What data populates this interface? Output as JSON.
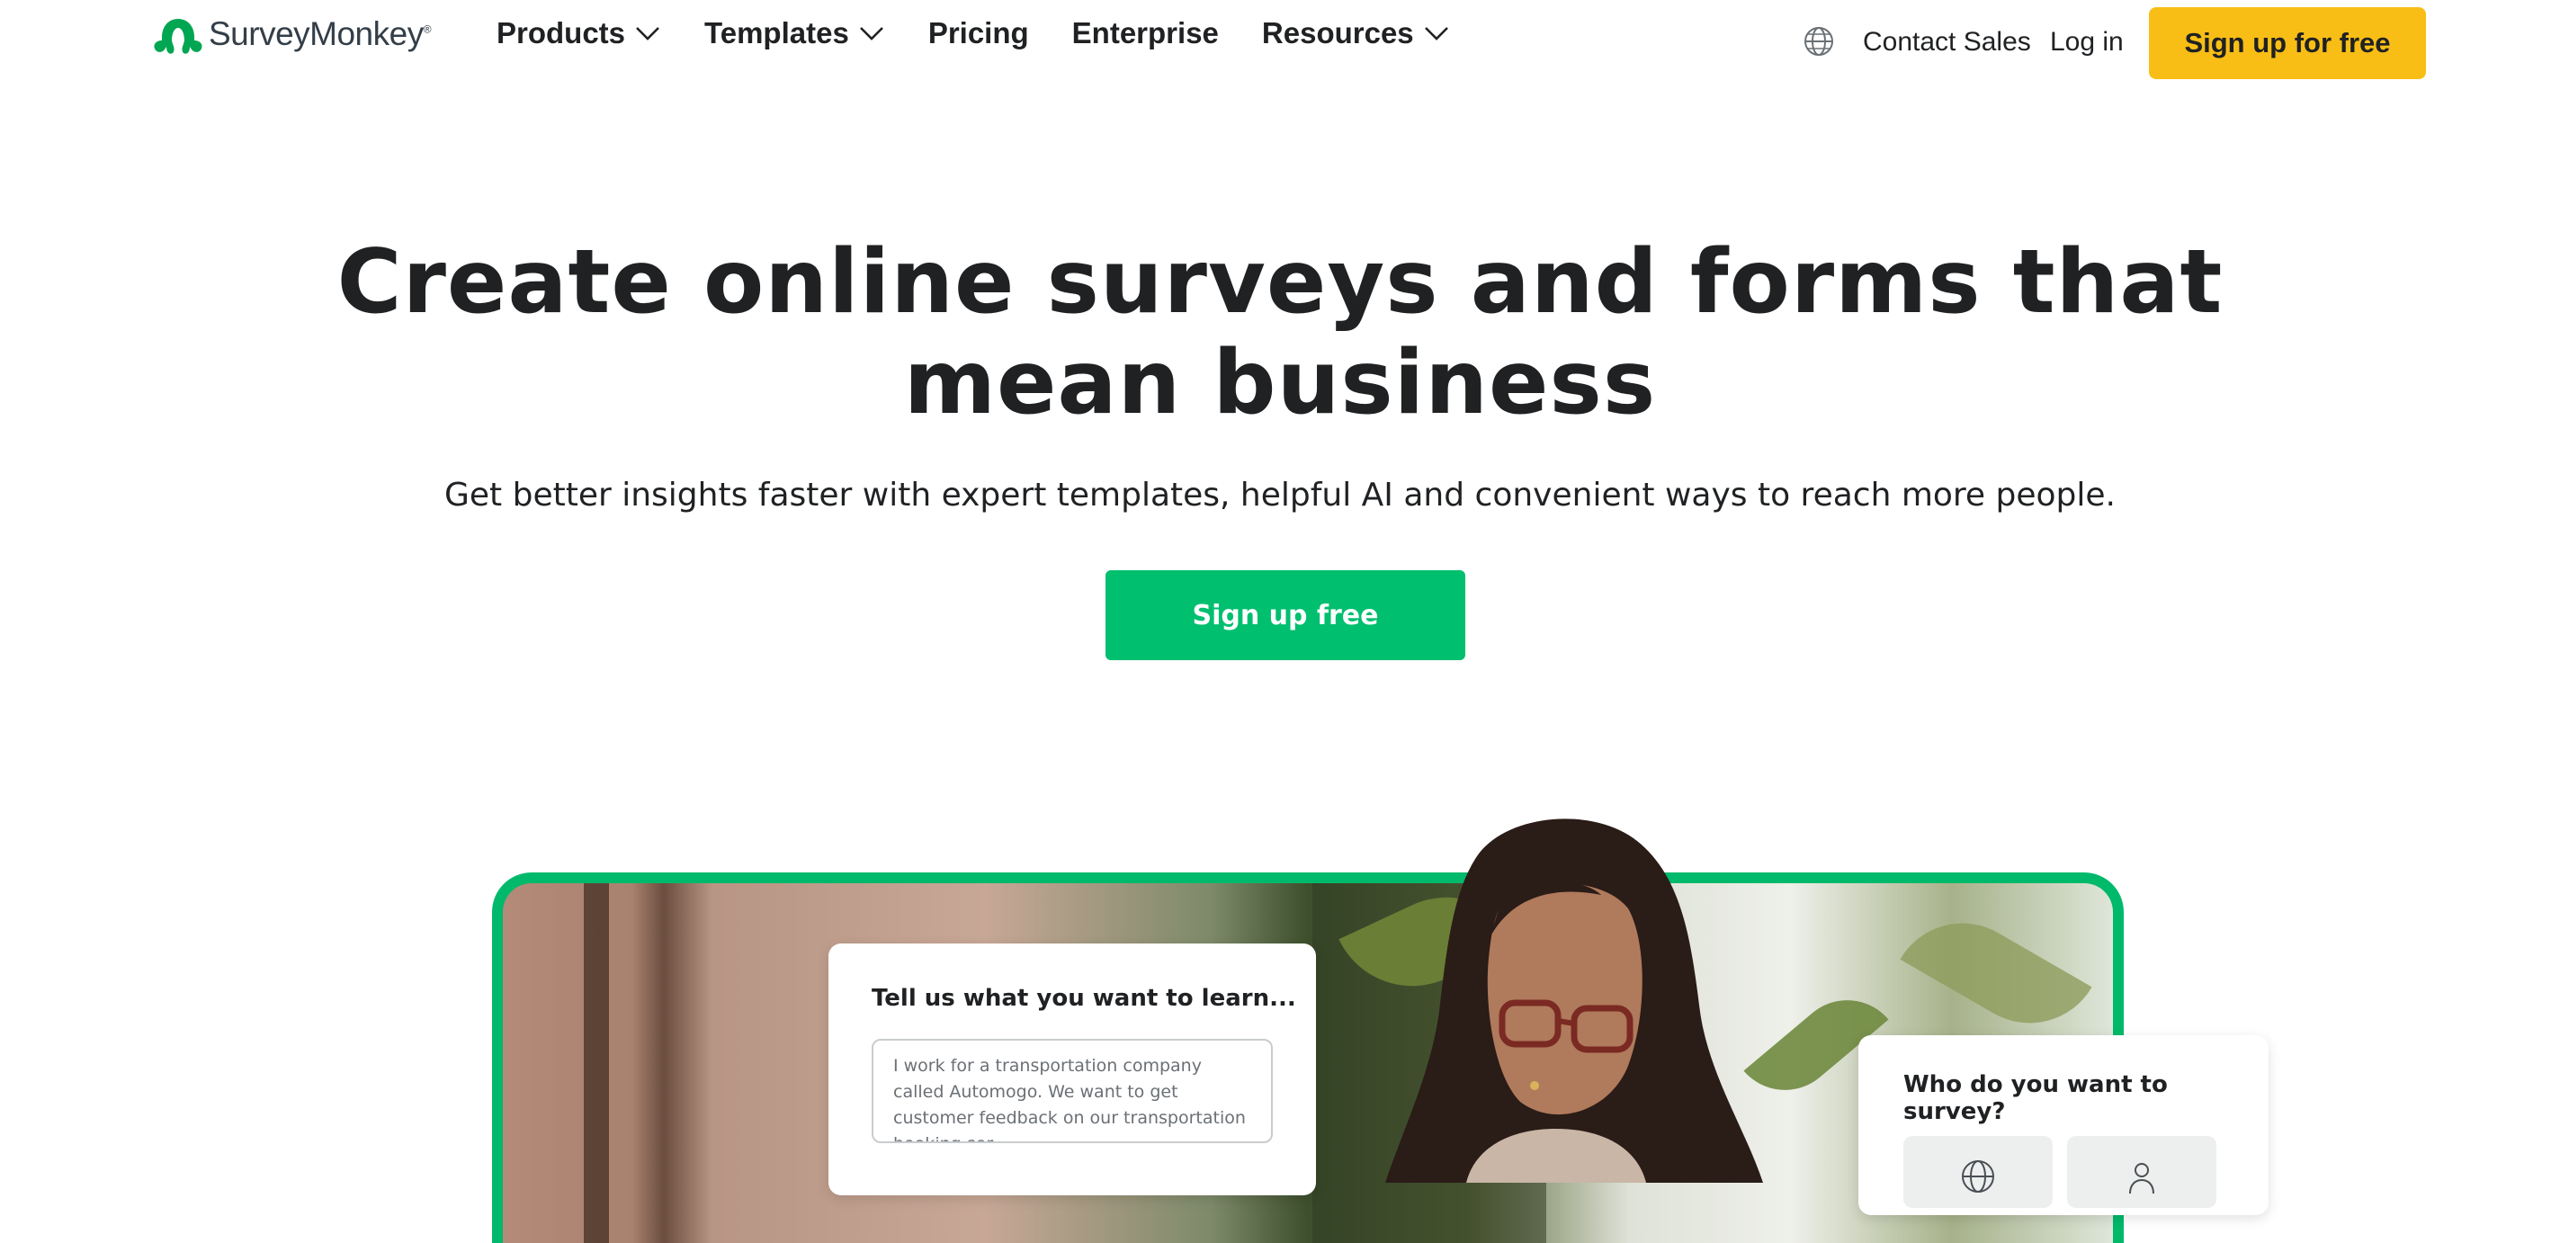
{
  "brand": {
    "name": "SurveyMonkey",
    "trademark": "®",
    "logo_icon": "surveymonkey-logo-icon",
    "colors": {
      "green": "#00bf6f",
      "yellow": "#f8be15",
      "text": "#1f2123"
    }
  },
  "nav": {
    "items": [
      {
        "label": "Products",
        "has_dropdown": true
      },
      {
        "label": "Templates",
        "has_dropdown": true
      },
      {
        "label": "Pricing",
        "has_dropdown": false
      },
      {
        "label": "Enterprise",
        "has_dropdown": false
      },
      {
        "label": "Resources",
        "has_dropdown": true
      }
    ],
    "language_icon": "globe-icon",
    "contact_sales": "Contact Sales",
    "log_in": "Log in",
    "sign_up": "Sign up for free"
  },
  "hero": {
    "title_line1": "Create online surveys and forms that",
    "title_line2": "mean business",
    "subtitle": "Get better insights faster with expert templates, helpful AI and convenient ways to reach more people.",
    "cta": "Sign up free"
  },
  "illustration": {
    "learn_card": {
      "title": "Tell us what you want to learn...",
      "input_text": "I work for a transportation company called Automogo. We want to get customer feedback on our transportation booking ser..."
    },
    "audience_card": {
      "title": "Who do you want to survey?",
      "options": [
        "globe-icon",
        "person-icon"
      ]
    }
  }
}
